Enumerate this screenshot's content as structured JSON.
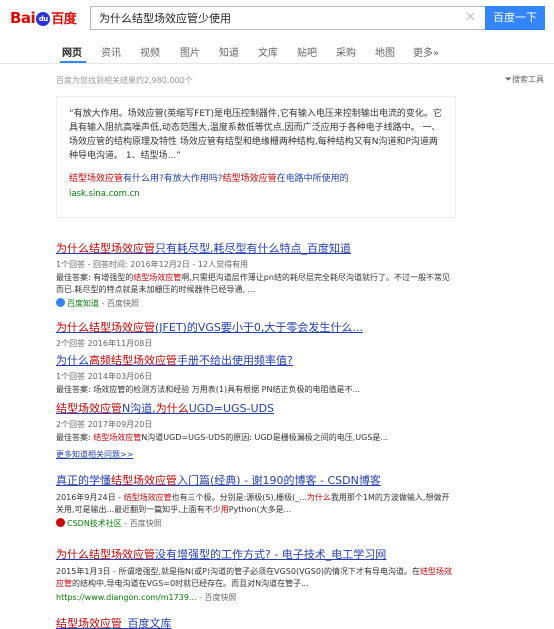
{
  "logo": {
    "bai": "Bai",
    "du": "du",
    "name": "百度"
  },
  "search": {
    "value": "为什么结型场效应管少使用",
    "button": "百度一下"
  },
  "nav": {
    "items": [
      "网页",
      "资讯",
      "视频",
      "图片",
      "知道",
      "文库",
      "贴吧",
      "采购",
      "地图",
      "更多»"
    ]
  },
  "result_count": "百度为您找到相关结果约2,980,000个",
  "search_tools": "搜索工具",
  "card": {
    "text": "“有放大作用。场效应管(英缩写FET)是电压控制器件,它有输入电压来控制输出电流的变化。它具有输入阻抗高噪声低,动态范围大,温度系数低等优点,因而广泛应用于各种电子线路中。 一、场效应管的结构原理及特性  场效应管有结型和绝缘栅两种结构,每种结构又有N沟道和P沟道两种导电沟道。 1、结型场...”",
    "link_pre": "",
    "link_hl": "结型场效应管",
    "link_mid": "有什么用?有放大作用吗?",
    "link_hl2": "结型场效应管",
    "link_post": "在电路中所使用的",
    "source": "iask.sina.com.cn"
  },
  "r1": {
    "title_hl": "为什么结型场效应管",
    "title_post": "只有耗尽型,耗尽型有什么特点_百度知道",
    "meta": "1个回答 - 回答时间: 2016年12月2日 - 12人觉得有用",
    "desc_pre": "最佳答案: 有增强型的",
    "desc_hl": "结型场效应管",
    "desc_post": "啊,只需把沟道层作薄让pn结的耗尽层完全耗尽沟道就行了。不过一般不常见而已.耗尽型的特点就是未加栅压的时候器件已经导通, ...",
    "url": "百度知道",
    "snap": "- 百度快照"
  },
  "r2": {
    "title_hl": "为什么结型场效应管",
    "title_post": "(JFET)的VGS要小于0,大于零会发生什么...",
    "meta": "2个回答  2016年11月08日"
  },
  "r3": {
    "title_pre": "为什么",
    "title_hl": "高频结型场效应管",
    "title_post": "手册不给出使用频率值?",
    "meta": "1个回答  2014年03月06日",
    "desc_pre": "最佳答案: 场效应管的检测方法和经验 万用表(1)具有根据 PN结正负极的电阻值是不..."
  },
  "r4": {
    "title_hl": "结型场效应管",
    "title_mid": "N沟道,",
    "title_hl2": "为什么",
    "title_post": "UGD=UGS-UDS",
    "meta": "2个回答  2017年09月20日",
    "desc_pre": "最佳答案: ",
    "desc_hl": "结型场效应管",
    "desc_post": "N沟道UGD=UGS-UDS的原因: UGD是栅极漏极之间的电压,UGS是..."
  },
  "more_link": "更多知道相关问题>>",
  "r5": {
    "title_pre": "真正的学懂",
    "title_hl": "结型场效应管",
    "title_post": "入门篇(经典) - 谢190的博客 - CSDN博客",
    "desc_pre": "2016年9月24日 - ",
    "desc_hl": "结型场效应管",
    "desc_mid": "也有三个极。分别是:源极(S),栅极(_...",
    "desc_hl2": "为什么",
    "desc_post": "我用那个1M的方波做输入,想做开关用,可是输出...最近翻到一篇知乎,上面有不",
    "desc_hl3": "少用",
    "desc_end": "Python(大多是...",
    "url": "CSDN技术社区",
    "snap": "- 百度快照"
  },
  "r6": {
    "title_hl": "为什么结型场效应管",
    "title_post": "没有增强型的工作方式? - 电子技术_电工学习网",
    "desc_pre": "2015年1月3日 - 所谓增强型,就是指N(或P)沟道的管子必须在VGS0(VGS0)的情况下才有导电沟道。在",
    "desc_hl": "结型场效应管",
    "desc_post": "的结构中,导电沟道在VGS=0时就已经存在。而且对N沟道在管子...",
    "url": "https://www.diangon.com/m1739...",
    "snap": "- 百度快照"
  },
  "r7": {
    "title_hl": "结型场效应管",
    "title_post": "_百度文库"
  }
}
